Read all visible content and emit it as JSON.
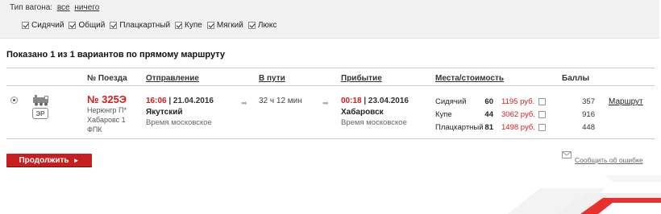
{
  "filters": {
    "label": "Тип вагона:",
    "select_all": "все",
    "select_none": "ничего",
    "types": [
      "Сидячий",
      "Общий",
      "Плацкартный",
      "Купе",
      "Мягкий",
      "Люкс"
    ]
  },
  "results": {
    "summary": "Показано 1 из 1 вариантов по прямому маршруту"
  },
  "columns": {
    "train": "№ Поезда",
    "departure": "Отправление",
    "travel": "В пути",
    "arrival": "Прибытие",
    "seats": "Места/стоимость",
    "points": "Баллы"
  },
  "train": {
    "number": "№ 325Э",
    "badge": "ЭР",
    "route_from": "Нерюнгр П*",
    "route_to": "Хабаровс 1",
    "carrier": "ФПК",
    "departure": {
      "time": "16:06",
      "date": "| 21.04.2016",
      "city": "Якутский",
      "tz": "Время московское"
    },
    "duration": "32 ч 12 мин",
    "arrival": {
      "time": "00:18",
      "date": "| 23.04.2016",
      "city": "Хабаровск",
      "tz": "Время московское"
    },
    "seats": [
      {
        "class": "Сидячий",
        "count": "60",
        "price": "1195 руб.",
        "points": "357"
      },
      {
        "class": "Купе",
        "count": "44",
        "price": "3062 руб.",
        "points": "916"
      },
      {
        "class": "Плацкартный",
        "count": "81",
        "price": "1498 руб.",
        "points": "448"
      }
    ],
    "route_link": "Маршрут"
  },
  "actions": {
    "continue": "Продолжить",
    "report_error": "Сообщить об ошибке"
  },
  "colors": {
    "accent": "#d71b1b",
    "button": "#c71f1f"
  }
}
